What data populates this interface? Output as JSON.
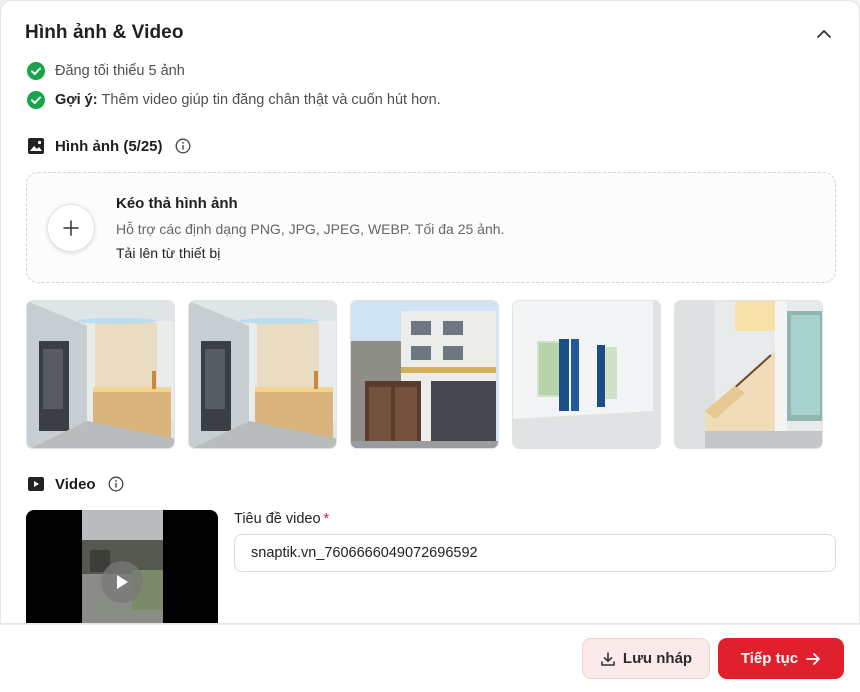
{
  "section": {
    "title": "Hình ảnh & Video"
  },
  "checks": [
    {
      "label": "",
      "text": "Đăng tối thiểu 5 ảnh"
    },
    {
      "label": "Gợi ý:",
      "text": "Thêm video giúp tin đăng chân thật và cuốn hút hơn."
    }
  ],
  "images": {
    "label": "Hình ảnh (5/25)",
    "dropzone": {
      "title": "Kéo thả hình ảnh",
      "subtitle": "Hỗ trợ các định dạng PNG, JPG, JPEG, WEBP. Tối đa 25 ảnh.",
      "link": "Tải lên từ thiết bị"
    },
    "thumbnails": [
      {
        "icon": "interior-hallway-photo"
      },
      {
        "icon": "interior-hallway-photo"
      },
      {
        "icon": "building-facade-photo"
      },
      {
        "icon": "room-blue-curtains-photo"
      },
      {
        "icon": "staircase-photo"
      }
    ]
  },
  "video": {
    "label": "Video",
    "title_label": "Tiêu đề video",
    "required_mark": "*",
    "title_value": "snaptik.vn_7606666049072696592"
  },
  "footer": {
    "draft_label": "Lưu nháp",
    "next_label": "Tiếp tục"
  },
  "colors": {
    "accent": "#e0202c",
    "check_green": "#19a34a",
    "draft_bg": "#fbeaea"
  }
}
